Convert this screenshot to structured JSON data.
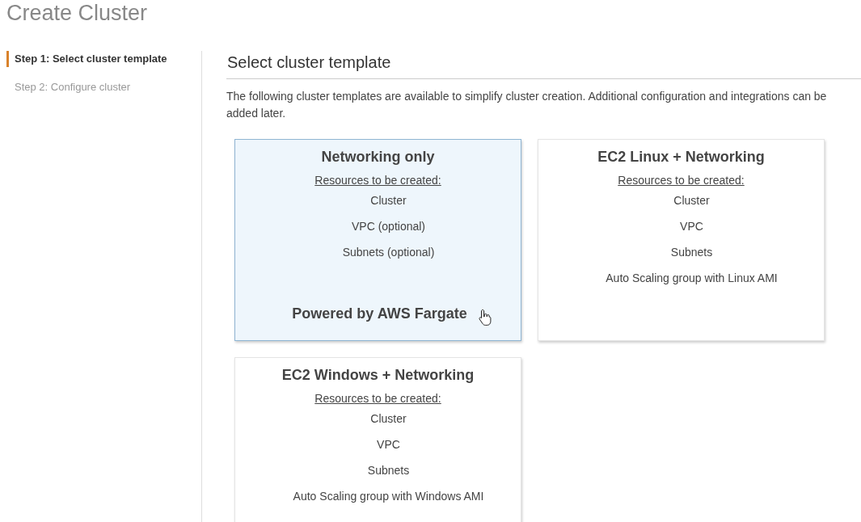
{
  "page_title": "Create Cluster",
  "steps": [
    {
      "label": "Step 1: Select cluster template",
      "selected": true
    },
    {
      "label": "Step 2: Configure cluster",
      "selected": false
    }
  ],
  "section": {
    "heading": "Select cluster template",
    "description": "The following cluster templates are available to simplify cluster creation. Additional configuration and integrations can be added later."
  },
  "templates": [
    {
      "title": "Networking only",
      "resources_label": "Resources to be created:",
      "resources": [
        "Cluster",
        "VPC (optional)",
        "Subnets (optional)"
      ],
      "footer": "Powered by AWS Fargate",
      "selected": true
    },
    {
      "title": "EC2 Linux + Networking",
      "resources_label": "Resources to be created:",
      "resources": [
        "Cluster",
        "VPC",
        "Subnets",
        "Auto Scaling group with Linux AMI"
      ],
      "selected": false
    },
    {
      "title": "EC2 Windows + Networking",
      "resources_label": "Resources to be created:",
      "resources": [
        "Cluster",
        "VPC",
        "Subnets",
        "Auto Scaling group with Windows AMI"
      ],
      "selected": false
    }
  ]
}
